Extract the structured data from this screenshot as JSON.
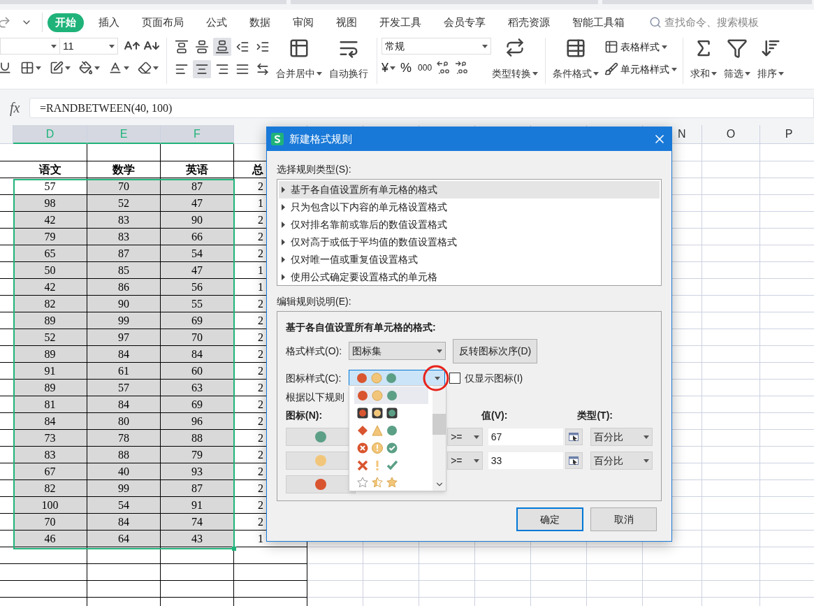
{
  "menu_tabs": [
    {
      "label": "开始",
      "selected": true
    },
    {
      "label": "插入",
      "selected": false
    },
    {
      "label": "页面布局",
      "selected": false
    },
    {
      "label": "公式",
      "selected": false
    },
    {
      "label": "数据",
      "selected": false
    },
    {
      "label": "审阅",
      "selected": false
    },
    {
      "label": "视图",
      "selected": false
    },
    {
      "label": "开发工具",
      "selected": false
    },
    {
      "label": "会员专享",
      "selected": false
    },
    {
      "label": "稻壳资源",
      "selected": false
    },
    {
      "label": "智能工具箱",
      "selected": false
    }
  ],
  "search": {
    "placeholder": "查找命令、搜索模板"
  },
  "ribbon": {
    "font_size": "11",
    "number_format": "常规",
    "currency": "¥",
    "percent": "%",
    "thousands": "000",
    "merge": "合并居中",
    "wrap": "自动换行",
    "convert": "类型转换",
    "conditional": "条件格式",
    "table_style": "表格样式",
    "cell_style": "单元格样式",
    "sum": "求和",
    "filter": "筛选",
    "sort": "排序"
  },
  "formula_bar": {
    "fx": "fx",
    "value": "=RANDBETWEEN(40, 100)"
  },
  "sheet": {
    "columns": [
      {
        "label": "D",
        "selected": true
      },
      {
        "label": "E",
        "selected": true
      },
      {
        "label": "F",
        "selected": true
      },
      {
        "label": "N",
        "selected": false
      },
      {
        "label": "O",
        "selected": false
      },
      {
        "label": "P",
        "selected": false
      }
    ],
    "headers": [
      "语文",
      "数学",
      "英语",
      "总"
    ],
    "rows": [
      {
        "cells": [
          "57",
          "70",
          "87",
          "2"
        ],
        "active": true
      },
      {
        "cells": [
          "98",
          "52",
          "47",
          "1"
        ],
        "active": false
      },
      {
        "cells": [
          "42",
          "83",
          "90",
          "2"
        ],
        "active": false
      },
      {
        "cells": [
          "79",
          "83",
          "66",
          "2"
        ],
        "active": false
      },
      {
        "cells": [
          "65",
          "87",
          "54",
          "2"
        ],
        "active": false
      },
      {
        "cells": [
          "50",
          "85",
          "47",
          "1"
        ],
        "active": false
      },
      {
        "cells": [
          "42",
          "86",
          "56",
          "1"
        ],
        "active": false
      },
      {
        "cells": [
          "82",
          "90",
          "55",
          "2"
        ],
        "active": false
      },
      {
        "cells": [
          "89",
          "99",
          "69",
          "2"
        ],
        "active": false
      },
      {
        "cells": [
          "52",
          "97",
          "70",
          "2"
        ],
        "active": false
      },
      {
        "cells": [
          "89",
          "84",
          "84",
          "2"
        ],
        "active": false
      },
      {
        "cells": [
          "91",
          "61",
          "60",
          "2"
        ],
        "active": false
      },
      {
        "cells": [
          "89",
          "57",
          "63",
          "2"
        ],
        "active": false
      },
      {
        "cells": [
          "81",
          "84",
          "69",
          "2"
        ],
        "active": false
      },
      {
        "cells": [
          "84",
          "80",
          "96",
          "2"
        ],
        "active": false
      },
      {
        "cells": [
          "73",
          "78",
          "88",
          "2"
        ],
        "active": false
      },
      {
        "cells": [
          "83",
          "88",
          "79",
          "2"
        ],
        "active": false
      },
      {
        "cells": [
          "67",
          "40",
          "93",
          "2"
        ],
        "active": false
      },
      {
        "cells": [
          "82",
          "99",
          "87",
          "2"
        ],
        "active": false
      },
      {
        "cells": [
          "100",
          "54",
          "91",
          "2"
        ],
        "active": false
      },
      {
        "cells": [
          "70",
          "84",
          "74",
          "2"
        ],
        "active": false
      },
      {
        "cells": [
          "46",
          "64",
          "43",
          "1"
        ],
        "active": false
      }
    ]
  },
  "dialog": {
    "title": "新建格式规则",
    "rule_type_label": "选择规则类型(S):",
    "rule_types": [
      {
        "label": "基于各自值设置所有单元格的格式",
        "selected": true
      },
      {
        "label": "只为包含以下内容的单元格设置格式",
        "selected": false
      },
      {
        "label": "仅对排名靠前或靠后的数值设置格式",
        "selected": false
      },
      {
        "label": "仅对高于或低于平均值的数值设置格式",
        "selected": false
      },
      {
        "label": "仅对唯一值或重复值设置格式",
        "selected": false
      },
      {
        "label": "使用公式确定要设置格式的单元格",
        "selected": false
      }
    ],
    "edit_label": "编辑规则说明(E):",
    "section_title": "基于各自值设置所有单元格的格式:",
    "format_style_label": "格式样式(O):",
    "format_style": "图标集",
    "reverse_button": "反转图标次序(D)",
    "icon_style_label": "图标样式(C):",
    "icon_style": {
      "kind": "circles"
    },
    "icons_only": {
      "label": "仅显示图标(I)",
      "checked": false
    },
    "rules_label": "根据以下规则",
    "icon_col": "图标(N):",
    "value_col": "值(V):",
    "type_col": "类型(T):",
    "rules": [
      {
        "color": "#5b9f86",
        "operator": ">=",
        "value": "67",
        "type": "百分比"
      },
      {
        "color": "#f2c67a",
        "operator": ">=",
        "value": "33",
        "type": "百分比"
      },
      {
        "color": "#d9552f"
      }
    ],
    "ok": "确定",
    "cancel": "取消",
    "icon_set_menu": [
      {
        "kind": "circles",
        "selected": true
      },
      {
        "kind": "traffic-lights",
        "selected": false
      },
      {
        "kind": "shapes",
        "selected": false
      },
      {
        "kind": "circled-symbols",
        "selected": false
      },
      {
        "kind": "symbols",
        "selected": false
      },
      {
        "kind": "stars",
        "selected": false
      }
    ]
  }
}
